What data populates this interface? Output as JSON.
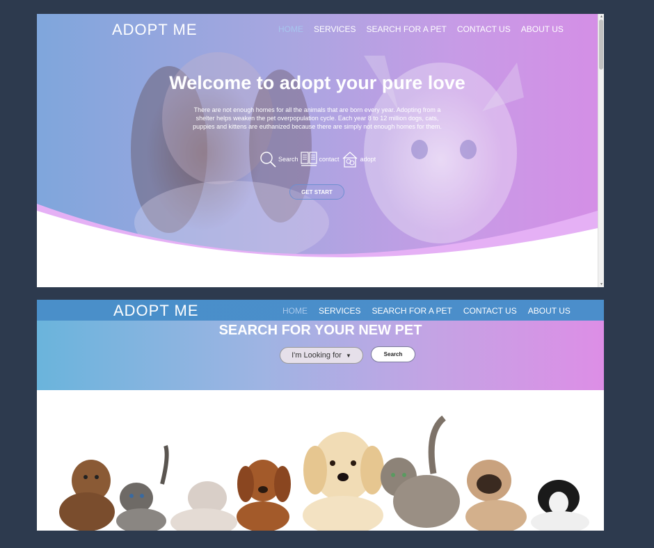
{
  "shot1": {
    "brand": "ADOPT ME",
    "nav": [
      "HOME",
      "SERVICES",
      "SEARCH FOR A PET",
      "CONTACT US",
      "ABOUT US"
    ],
    "active_nav": "HOME",
    "title": "Welcome to adopt your pure love",
    "text": "There are not enough homes for all the animals that are born every year. Adopting from a shelter helps weaken the pet overpopulation cycle. Each year 8 to 12 million dogs, cats, puppies and kittens are euthanized because there are simply not enough homes for them.",
    "icons": [
      {
        "icon": "search-icon",
        "label": "Search"
      },
      {
        "icon": "book-icon",
        "label": "contact"
      },
      {
        "icon": "house-pet-icon",
        "label": "adopt"
      }
    ],
    "cta": "GET START"
  },
  "shot2": {
    "brand": "ADOPT ME",
    "nav": [
      "HOME",
      "SERVICES",
      "SEARCH FOR A PET",
      "CONTACT US",
      "ABOUT US"
    ],
    "active_nav": "HOME",
    "title": "SEARCH FOR YOUR NEW PET",
    "dropdown_label": "I'm Looking for",
    "search_label": "Search"
  },
  "colors": {
    "page_bg": "#2d3a4e",
    "hero_gradient_start": "#7fa6dc",
    "hero_gradient_end": "#d48fe6",
    "wave_pink": "#e5b0f5",
    "nav_bar_blue": "#4a8fc9"
  }
}
